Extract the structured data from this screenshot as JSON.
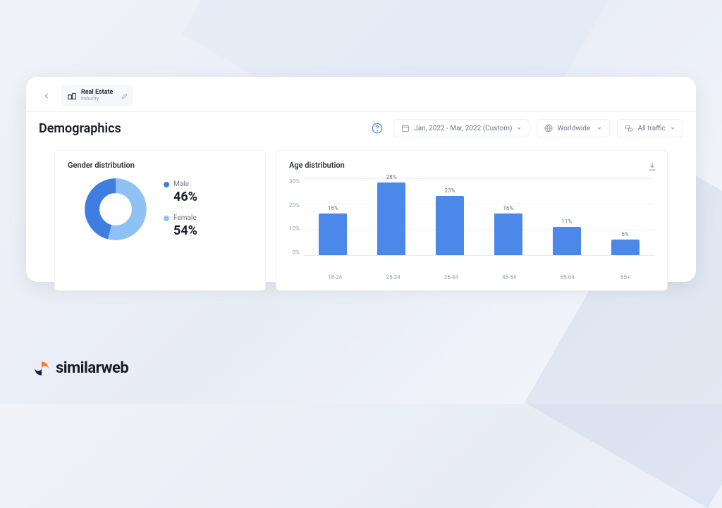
{
  "context": {
    "title": "Real Estate",
    "subtitle": "Industry"
  },
  "page_title": "Demographics",
  "controls": {
    "date_range": "Jan, 2022 - Mar, 2022 (Custom)",
    "region": "Worldwide",
    "traffic": "All traffic"
  },
  "gender_card": {
    "title": "Gender distribution",
    "male_label": "Male",
    "male_pct": "46%",
    "female_label": "Female",
    "female_pct": "54%",
    "colors": {
      "male": "#3f7de0",
      "female": "#8fc1f5"
    }
  },
  "age_card": {
    "title": "Age distribution",
    "y_ticks": [
      "30%",
      "20%",
      "10%",
      "0%"
    ]
  },
  "brand": "similarweb",
  "chart_data": [
    {
      "type": "pie",
      "title": "Gender distribution",
      "series": [
        {
          "name": "Male",
          "value": 46,
          "color": "#3f7de0"
        },
        {
          "name": "Female",
          "value": 54,
          "color": "#8fc1f5"
        }
      ]
    },
    {
      "type": "bar",
      "title": "Age distribution",
      "categories": [
        "18-24",
        "25-34",
        "35-44",
        "45-54",
        "55-64",
        "65+"
      ],
      "values": [
        16,
        28,
        23,
        16,
        11,
        6
      ],
      "ylabel": "%",
      "ylim": [
        0,
        30
      ]
    }
  ]
}
